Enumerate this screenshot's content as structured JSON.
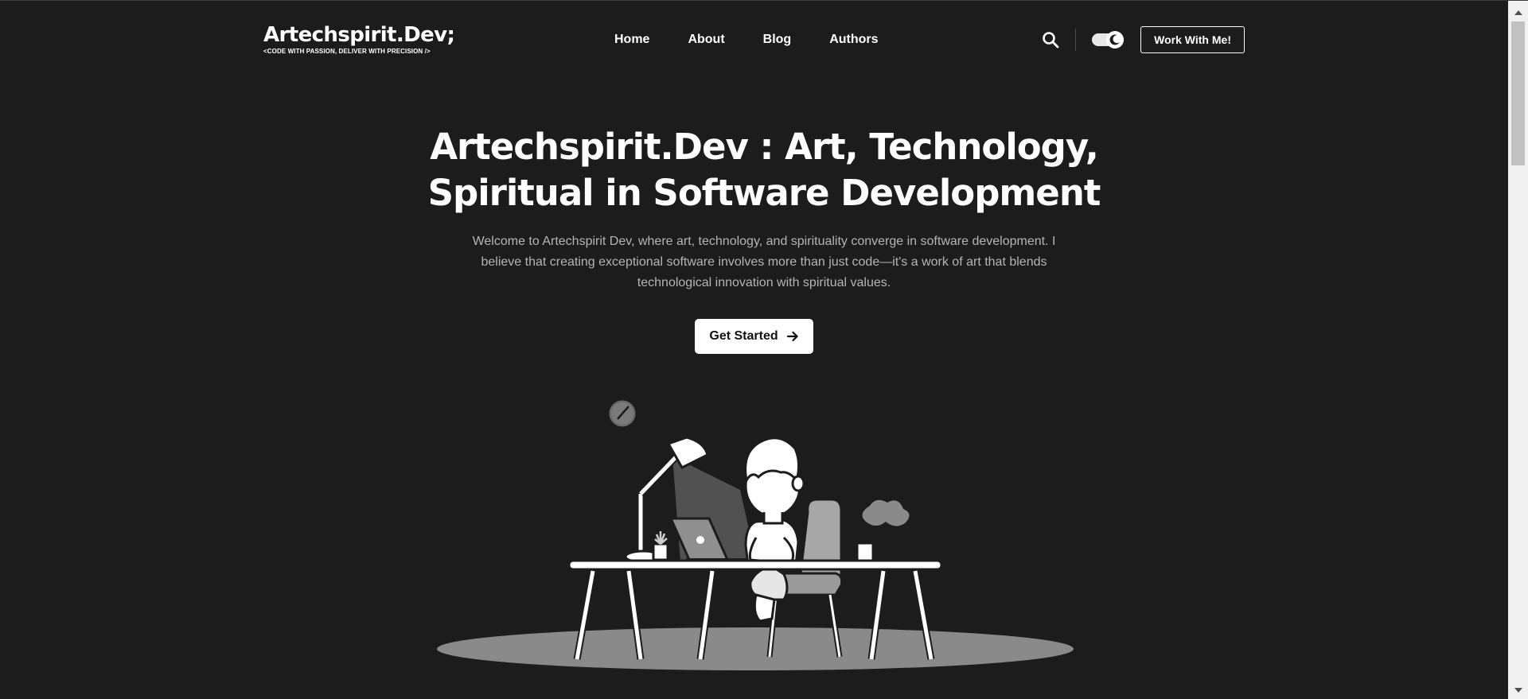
{
  "header": {
    "brand_title": "Artechspirit.Dev;",
    "brand_tagline": "<CODE WITH PASSION, DELIVER WITH PRECISION />",
    "nav": [
      "Home",
      "About",
      "Blog",
      "Authors"
    ],
    "search_icon": "search-icon",
    "theme_toggle_icon": "moon-icon",
    "cta_label": "Work With Me!"
  },
  "hero": {
    "title_line1": "Artechspirit.Dev : Art, Technology,",
    "title_line2": "Spiritual in Software Development",
    "description": "Welcome to Artechspirit Dev, where art, technology, and spirituality converge in software development. I believe that creating exceptional software involves more than just code—it's a work of art that blends technological innovation with spiritual values.",
    "button_label": "Get Started",
    "button_icon": "arrow-right-icon"
  },
  "colors": {
    "background": "#1c1c1c",
    "text": "#ffffff",
    "muted_text": "#b5b5b5"
  }
}
